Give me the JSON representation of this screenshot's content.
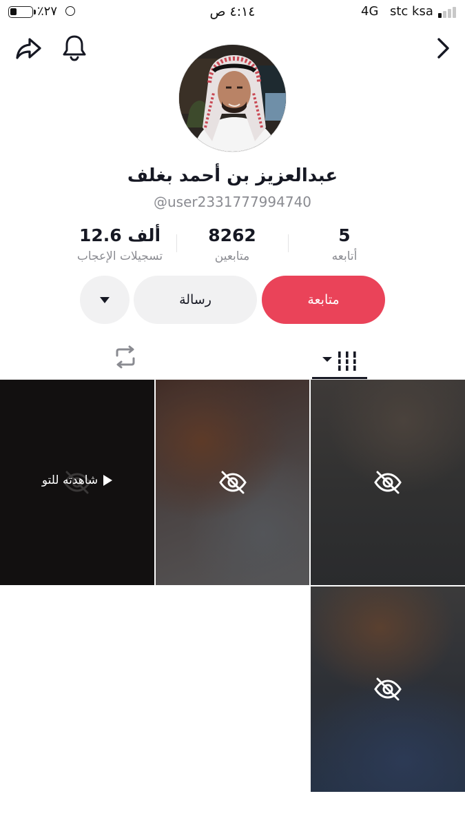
{
  "status_bar": {
    "battery_percent": "٪٢٧",
    "time": "٤:١٤ ص",
    "network": "4G",
    "carrier": "stc ksa"
  },
  "header": {
    "share_icon": "share-arrow-icon",
    "bell_icon": "bell-icon",
    "back_icon": "chevron-right-icon"
  },
  "profile": {
    "display_name": "عبدالعزيز بن أحمد بغلف",
    "username": "@user2331777994740",
    "avatar": "profile-photo"
  },
  "stats": [
    {
      "value": "5",
      "label": "أتابعه"
    },
    {
      "value": "8262",
      "label": "متابعين"
    },
    {
      "value": "12.6 ألف",
      "label": "تسجيلات الإعجاب"
    }
  ],
  "actions": {
    "follow_label": "متابعة",
    "message_label": "رسالة",
    "more_icon": "caret-down-icon"
  },
  "tabs": {
    "videos_icon": "grid-columns-icon",
    "reposts_icon": "repost-icon"
  },
  "grid": {
    "watched_label": "شاهدته للتو",
    "tiles": [
      {
        "state": "watched",
        "hidden_icon": "eye-slash-icon"
      },
      {
        "state": "hidden",
        "hidden_icon": "eye-slash-icon"
      },
      {
        "state": "hidden",
        "hidden_icon": "eye-slash-icon"
      },
      {
        "state": "hidden",
        "hidden_icon": "eye-slash-icon"
      }
    ]
  },
  "colors": {
    "follow_button": "#ea4359",
    "secondary_button": "#f1f1f2",
    "muted_text": "#8a8b91",
    "primary_text": "#161823"
  }
}
